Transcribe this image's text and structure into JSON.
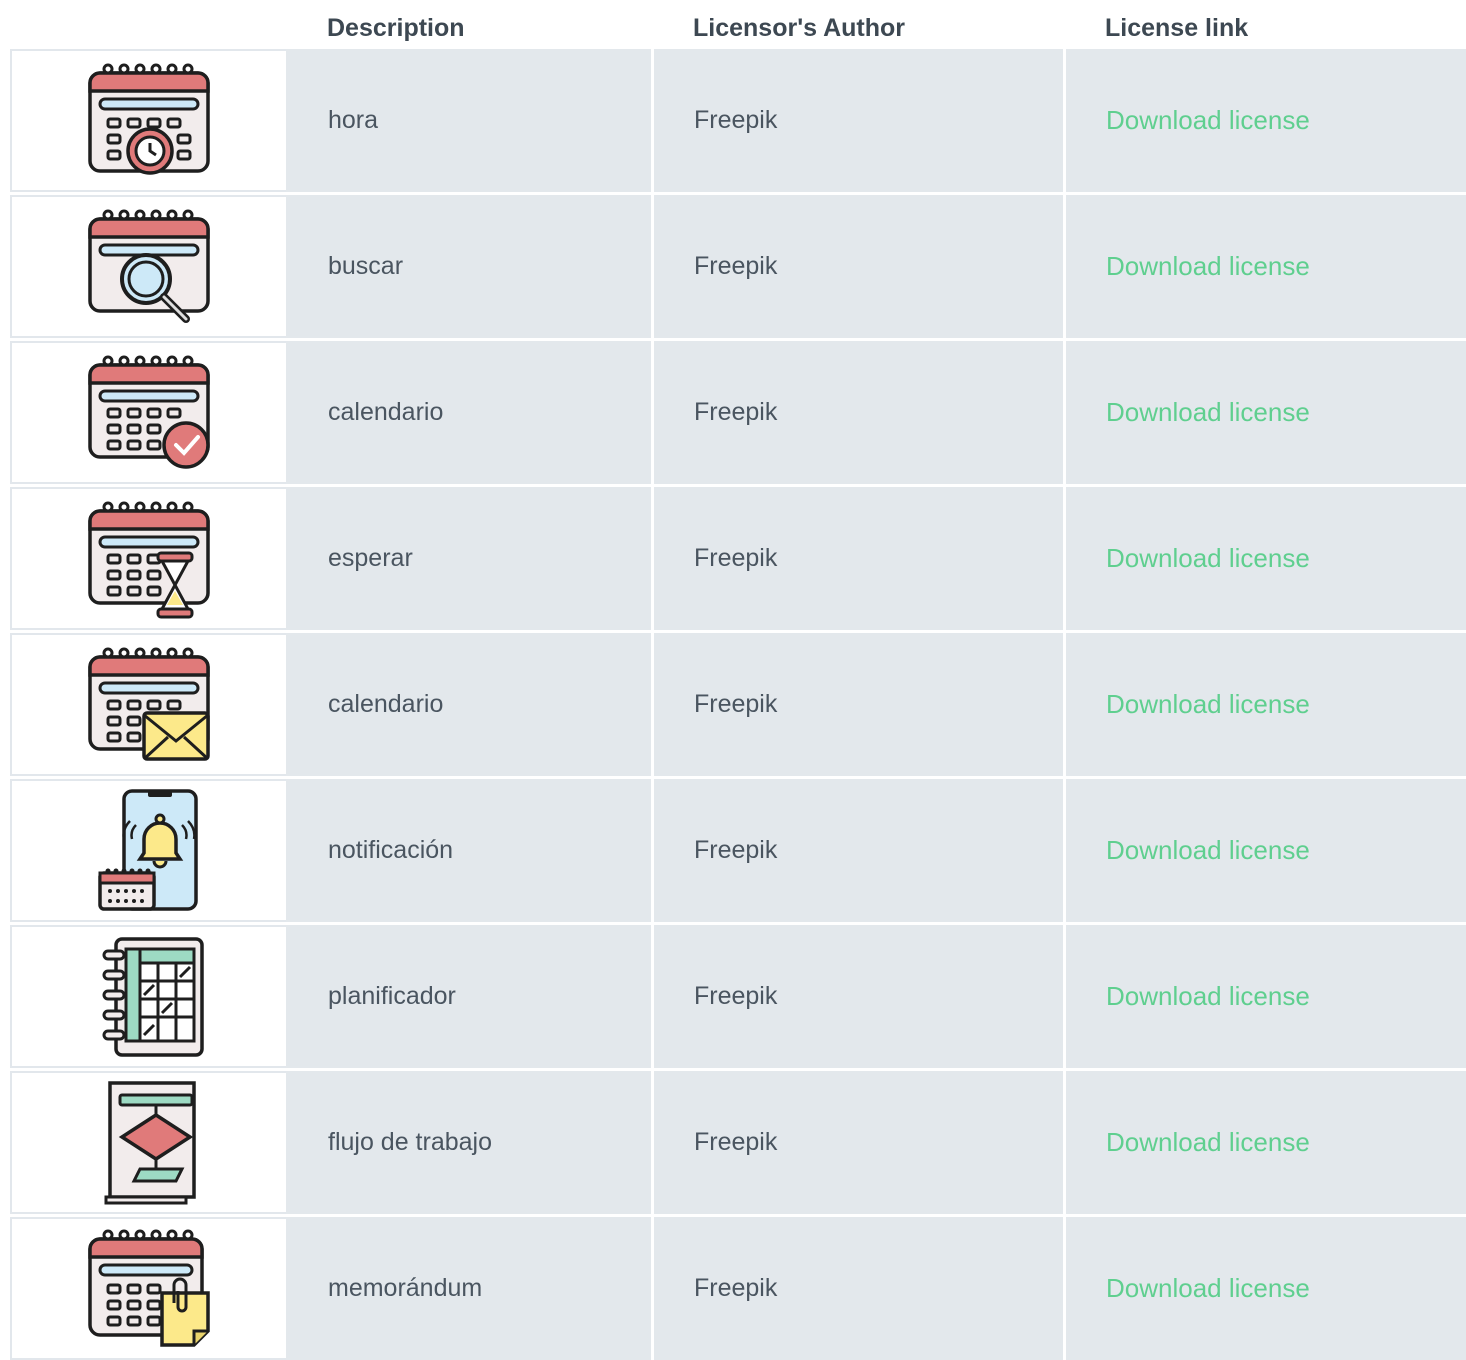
{
  "header": {
    "description": "Description",
    "author": "Licensor's Author",
    "license": "License link"
  },
  "rows": [
    {
      "icon": "calendar-clock-icon",
      "description": "hora",
      "author": "Freepik",
      "link": "Download license"
    },
    {
      "icon": "calendar-search-icon",
      "description": "buscar",
      "author": "Freepik",
      "link": "Download license"
    },
    {
      "icon": "calendar-check-icon",
      "description": "calendario",
      "author": "Freepik",
      "link": "Download license"
    },
    {
      "icon": "calendar-hourglass-icon",
      "description": "esperar",
      "author": "Freepik",
      "link": "Download license"
    },
    {
      "icon": "calendar-mail-icon",
      "description": "calendario",
      "author": "Freepik",
      "link": "Download license"
    },
    {
      "icon": "phone-bell-icon",
      "description": "notificación",
      "author": "Freepik",
      "link": "Download license"
    },
    {
      "icon": "planner-icon",
      "description": "planificador",
      "author": "Freepik",
      "link": "Download license"
    },
    {
      "icon": "workflow-icon",
      "description": "flujo de trabajo",
      "author": "Freepik",
      "link": "Download license"
    },
    {
      "icon": "calendar-memo-icon",
      "description": "memorándum",
      "author": "Freepik",
      "link": "Download license"
    }
  ],
  "colors": {
    "row_bg": "#e3e8ec",
    "link": "#5fcf8f",
    "header_text": "#3d4852",
    "icon_red": "#e07a7a",
    "icon_blue": "#cde9f8",
    "icon_yellow": "#fce98a",
    "icon_green": "#9ddac3"
  }
}
